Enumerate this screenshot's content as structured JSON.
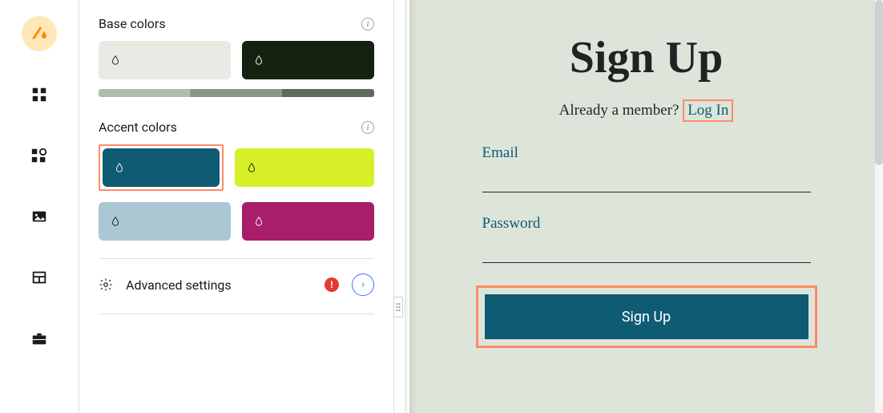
{
  "rail": {
    "items": [
      {
        "name": "theme-icon"
      },
      {
        "name": "grid-icon"
      },
      {
        "name": "widgets-icon"
      },
      {
        "name": "image-icon"
      },
      {
        "name": "layout-icon"
      },
      {
        "name": "briefcase-icon"
      }
    ]
  },
  "panel": {
    "base_title": "Base colors",
    "accent_title": "Accent colors",
    "advanced_label": "Advanced settings",
    "base_colors": [
      "#E8EBE3",
      "#142310"
    ],
    "gradient_stops": [
      "#B0BCA8",
      "#8A9683",
      "#5E6B59"
    ],
    "accent_colors": [
      "#0F5B74",
      "#D6EF28",
      "#ABC7D3",
      "#A81E6A"
    ],
    "selected_accent_index": 0,
    "warn_symbol": "!"
  },
  "preview": {
    "title": "Sign Up",
    "member_text": "Already a member? ",
    "login_text": "Log In",
    "email_label": "Email",
    "password_label": "Password",
    "button_label": "Sign Up"
  }
}
